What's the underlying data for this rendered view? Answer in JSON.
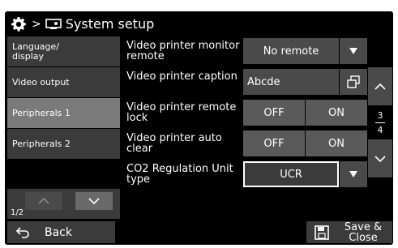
{
  "header": {
    "breadcrumb_sep": ">",
    "title": "System setup"
  },
  "nav": {
    "items": [
      {
        "label": "Language/ display",
        "active": false
      },
      {
        "label": "Video output",
        "active": false
      },
      {
        "label": "Peripherals 1",
        "active": true
      },
      {
        "label": "Peripherals 2",
        "active": false
      }
    ],
    "page": "1/2"
  },
  "settings": {
    "rows": [
      {
        "label": "Video printer monitor remote",
        "value": "No remote"
      },
      {
        "label": "Video printer caption",
        "value": "Abcde"
      },
      {
        "label": "Video printer remote lock",
        "off": "OFF",
        "on": "ON"
      },
      {
        "label": "Video printer auto clear",
        "off": "OFF",
        "on": "ON"
      },
      {
        "label": "CO2 Regulation Unit type",
        "value": "UCR"
      }
    ]
  },
  "scroll": {
    "page_current": "3",
    "page_total": "4"
  },
  "footer": {
    "back_label": "Back",
    "save_label": "Save & Close"
  },
  "colors": {
    "background": "#000000",
    "button": "#4a4a4a",
    "active_nav": "#7a7a7a",
    "text": "#ffffff"
  }
}
